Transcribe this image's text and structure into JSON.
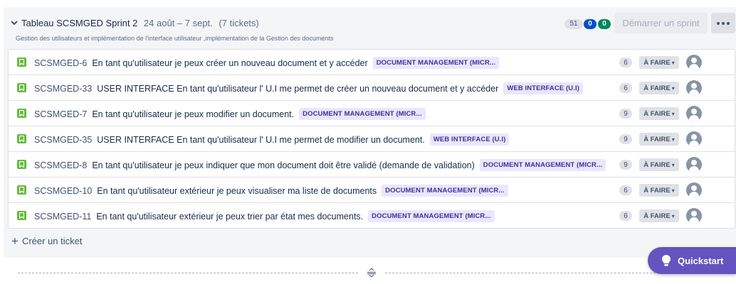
{
  "sprint": {
    "name": "Tableau SCSMGED Sprint 2",
    "dates": "24 août – 7 sept.",
    "ticket_count": "(7 tickets)",
    "goal": "Gestion des utilisateurs et implémentation de l'interface utilisateur ,implémentation de la Gestion des documents",
    "points_todo": "51",
    "points_in_progress": "0",
    "points_done": "0",
    "start_label": "Démarrer un sprint"
  },
  "issues": [
    {
      "key": "SCSMGED-6",
      "summary": "En tant qu'utilisateur je peux créer un nouveau document et y accéder",
      "epic": "DOCUMENT MANAGEMENT (MICR...",
      "points": "6",
      "status": "À FAIRE"
    },
    {
      "key": "SCSMGED-33",
      "summary": "USER INTERFACE En tant qu'utilisateur l' U.I me permet de créer un nouveau document et y accéder",
      "epic": "WEB INTERFACE (U.I)",
      "points": "6",
      "status": "À FAIRE"
    },
    {
      "key": "SCSMGED-7",
      "summary": "En tant qu'utilisateur je peux modifier un document.",
      "epic": "DOCUMENT MANAGEMENT (MICR...",
      "points": "9",
      "status": "À FAIRE"
    },
    {
      "key": "SCSMGED-35",
      "summary": "USER INTERFACE En tant qu'utilisateur l' U.I me permet de modifier un document.",
      "epic": "WEB INTERFACE (U.I)",
      "points": "9",
      "status": "À FAIRE"
    },
    {
      "key": "SCSMGED-8",
      "summary": "En tant qu'utilisateur je peux indiquer que mon document doit être validé (demande de validation)",
      "epic": "DOCUMENT MANAGEMENT (MICR...",
      "points": "9",
      "status": "À FAIRE"
    },
    {
      "key": "SCSMGED-10",
      "summary": "En tant qu'utilisateur extérieur je peux visualiser ma liste de documents",
      "epic": "DOCUMENT MANAGEMENT (MICR...",
      "points": "6",
      "status": "À FAIRE"
    },
    {
      "key": "SCSMGED-11",
      "summary": "En tant qu'utilisateur extérieur je peux trier par état mes documents.",
      "epic": "DOCUMENT MANAGEMENT (MICR...",
      "points": "6",
      "status": "À FAIRE"
    }
  ],
  "create_ticket_label": "Créer un ticket",
  "quickstart_label": "Quickstart",
  "colors": {
    "story": "#63ba3c",
    "epic_bg": "#eae6ff",
    "epic_text": "#403294",
    "in_progress_pill": "#0052cc",
    "done_pill": "#00875a",
    "quickstart": "#6554c0"
  },
  "icons": {
    "collapse": "chevron-down-icon",
    "story": "story-icon",
    "more": "more-icon",
    "assignee": "unassigned-avatar-icon",
    "create": "plus-icon",
    "resize": "resize-handle-icon",
    "quickstart": "lightbulb-icon"
  }
}
